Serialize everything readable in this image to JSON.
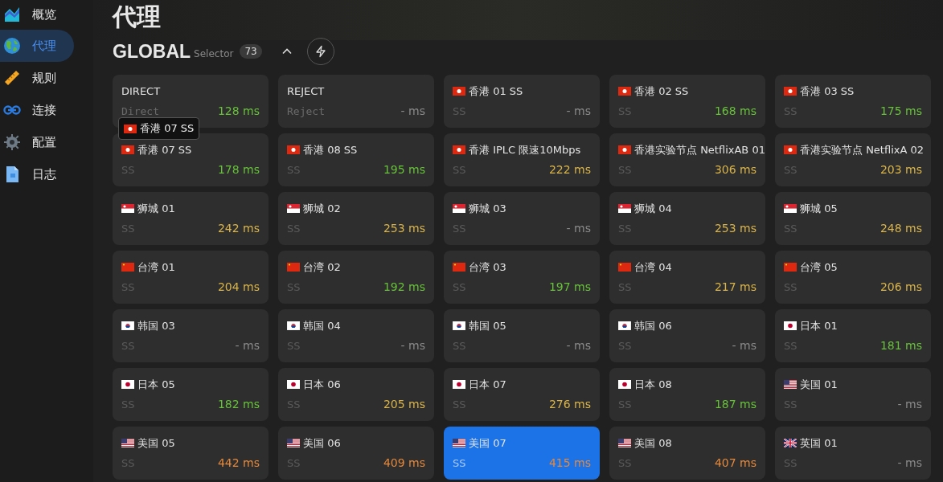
{
  "sidebar": {
    "items": [
      {
        "label": "概览",
        "selected": false
      },
      {
        "label": "代理",
        "selected": true
      },
      {
        "label": "规则",
        "selected": false
      },
      {
        "label": "连接",
        "selected": false
      },
      {
        "label": "配置",
        "selected": false
      },
      {
        "label": "日志",
        "selected": false
      }
    ]
  },
  "page": {
    "title": "代理"
  },
  "group": {
    "name": "GLOBAL",
    "type": "Selector",
    "count": "73",
    "expanded": true
  },
  "tooltip": {
    "kind": "hk",
    "text": "香港 07 SS"
  },
  "proxies": [
    {
      "name": "DIRECT",
      "type": "Direct",
      "delay": "128 ms",
      "color": "#67c23a",
      "selected": false
    },
    {
      "name": "REJECT",
      "type": "Reject",
      "delay": "- ms",
      "color": "#8a8a8a",
      "selected": false
    },
    {
      "kind": "hk",
      "name": "香港 01 SS",
      "type": "SS",
      "delay": "- ms",
      "color": "#8a8a8a",
      "selected": false
    },
    {
      "kind": "hk",
      "name": "香港 02 SS",
      "type": "SS",
      "delay": "168 ms",
      "color": "#67c23a",
      "selected": false
    },
    {
      "kind": "hk",
      "name": "香港 03 SS",
      "type": "SS",
      "delay": "175 ms",
      "color": "#67c23a",
      "selected": false
    },
    {
      "kind": "hk",
      "name": "香港 07 SS",
      "type": "SS",
      "delay": "178 ms",
      "color": "#67c23a",
      "selected": false
    },
    {
      "kind": "hk",
      "name": "香港 08 SS",
      "type": "SS",
      "delay": "195 ms",
      "color": "#67c23a",
      "selected": false
    },
    {
      "kind": "hk",
      "name": "香港 IPLC 限速10Mbps",
      "type": "SS",
      "delay": "222 ms",
      "color": "#d9b44a",
      "selected": false
    },
    {
      "kind": "hk",
      "name": "香港实验节点 NetflixAB 01",
      "type": "SS",
      "delay": "306 ms",
      "color": "#d9b44a",
      "selected": false
    },
    {
      "kind": "hk",
      "name": "香港实验节点 NetflixA 02",
      "type": "SS",
      "delay": "203 ms",
      "color": "#d9b44a",
      "selected": false
    },
    {
      "kind": "sg",
      "name": "狮城 01",
      "type": "SS",
      "delay": "242 ms",
      "color": "#d9b44a",
      "selected": false
    },
    {
      "kind": "sg",
      "name": "狮城 02",
      "type": "SS",
      "delay": "253 ms",
      "color": "#d9b44a",
      "selected": false
    },
    {
      "kind": "sg",
      "name": "狮城 03",
      "type": "SS",
      "delay": "- ms",
      "color": "#8a8a8a",
      "selected": false
    },
    {
      "kind": "sg",
      "name": "狮城 04",
      "type": "SS",
      "delay": "253 ms",
      "color": "#d9b44a",
      "selected": false
    },
    {
      "kind": "sg",
      "name": "狮城 05",
      "type": "SS",
      "delay": "248 ms",
      "color": "#d9b44a",
      "selected": false
    },
    {
      "kind": "tw",
      "name": "台湾 01",
      "type": "SS",
      "delay": "204 ms",
      "color": "#d9b44a",
      "selected": false
    },
    {
      "kind": "tw",
      "name": "台湾 02",
      "type": "SS",
      "delay": "192 ms",
      "color": "#67c23a",
      "selected": false
    },
    {
      "kind": "tw",
      "name": "台湾 03",
      "type": "SS",
      "delay": "197 ms",
      "color": "#67c23a",
      "selected": false
    },
    {
      "kind": "tw",
      "name": "台湾 04",
      "type": "SS",
      "delay": "217 ms",
      "color": "#d9b44a",
      "selected": false
    },
    {
      "kind": "tw",
      "name": "台湾 05",
      "type": "SS",
      "delay": "206 ms",
      "color": "#d9b44a",
      "selected": false
    },
    {
      "kind": "kr",
      "name": "韩国 03",
      "type": "SS",
      "delay": "- ms",
      "color": "#8a8a8a",
      "selected": false
    },
    {
      "kind": "kr",
      "name": "韩国 04",
      "type": "SS",
      "delay": "- ms",
      "color": "#8a8a8a",
      "selected": false
    },
    {
      "kind": "kr",
      "name": "韩国 05",
      "type": "SS",
      "delay": "- ms",
      "color": "#8a8a8a",
      "selected": false
    },
    {
      "kind": "kr",
      "name": "韩国 06",
      "type": "SS",
      "delay": "- ms",
      "color": "#8a8a8a",
      "selected": false
    },
    {
      "kind": "jp",
      "name": "日本 01",
      "type": "SS",
      "delay": "181 ms",
      "color": "#67c23a",
      "selected": false
    },
    {
      "kind": "jp",
      "name": "日本 05",
      "type": "SS",
      "delay": "182 ms",
      "color": "#67c23a",
      "selected": false
    },
    {
      "kind": "jp",
      "name": "日本 06",
      "type": "SS",
      "delay": "205 ms",
      "color": "#d9b44a",
      "selected": false
    },
    {
      "kind": "jp",
      "name": "日本 07",
      "type": "SS",
      "delay": "276 ms",
      "color": "#d9b44a",
      "selected": false
    },
    {
      "kind": "jp",
      "name": "日本 08",
      "type": "SS",
      "delay": "187 ms",
      "color": "#67c23a",
      "selected": false
    },
    {
      "kind": "us",
      "name": "美国 01",
      "type": "SS",
      "delay": "- ms",
      "color": "#8a8a8a",
      "selected": false
    },
    {
      "kind": "us",
      "name": "美国 05",
      "type": "SS",
      "delay": "442 ms",
      "color": "#e6883a",
      "selected": false
    },
    {
      "kind": "us",
      "name": "美国 06",
      "type": "SS",
      "delay": "409 ms",
      "color": "#e6883a",
      "selected": false
    },
    {
      "kind": "us",
      "name": "美国 07",
      "type": "SS",
      "delay": "415 ms",
      "color": "#e6883a",
      "selected": true
    },
    {
      "kind": "us",
      "name": "美国 08",
      "type": "SS",
      "delay": "407 ms",
      "color": "#e6883a",
      "selected": false
    },
    {
      "kind": "uk",
      "name": "英国 01",
      "type": "SS",
      "delay": "- ms",
      "color": "#8a8a8a",
      "selected": false
    }
  ]
}
